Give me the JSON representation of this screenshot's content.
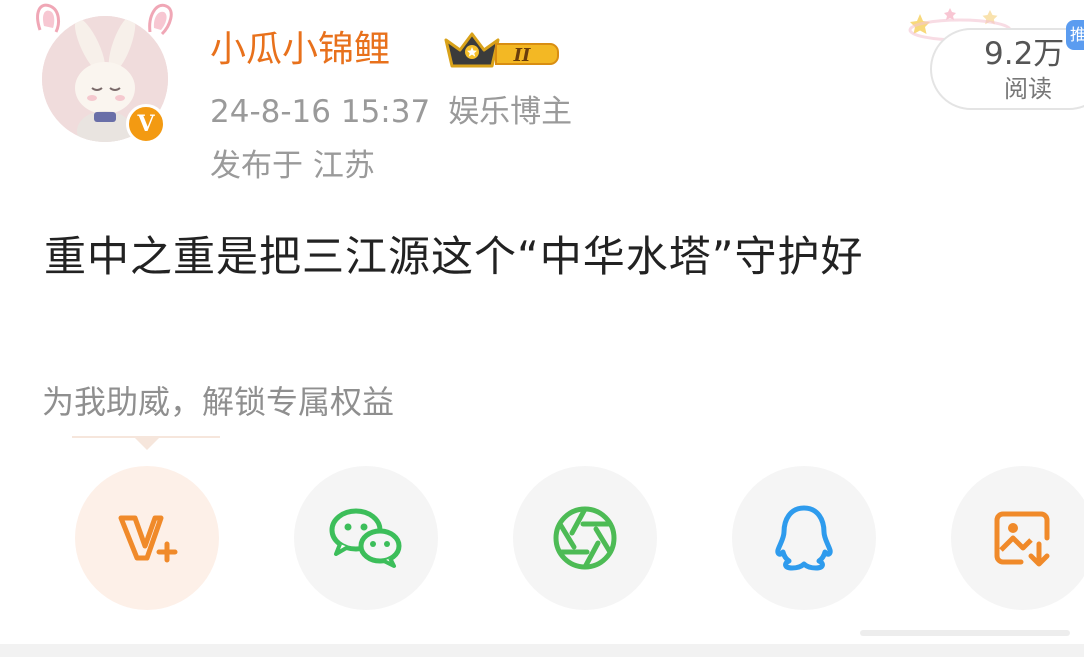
{
  "post": {
    "author": {
      "name": "小瓜小锦鲤",
      "verified_badge_letter": "V",
      "member_level": "II",
      "badge_color": "#f39a12",
      "name_color": "#e8711c"
    },
    "timestamp": "24-8-16 15:37",
    "role": "娱乐博主",
    "location": "发布于 江苏",
    "reads": {
      "count": "9.2万",
      "label": "阅读"
    },
    "pin_tab": "推",
    "content": "重中之重是把三江源这个“中华水塔”守护好"
  },
  "support": {
    "text": "为我助威，解锁专属权益"
  },
  "share_actions": [
    {
      "icon": "vip-support-icon",
      "color": "#f08a2a"
    },
    {
      "icon": "wechat-icon",
      "color": "#3cbe5a"
    },
    {
      "icon": "moments-icon",
      "color": "#4dbb55"
    },
    {
      "icon": "qq-icon",
      "color": "#2e9bed"
    },
    {
      "icon": "save-image-icon",
      "color": "#f08a2a"
    }
  ]
}
